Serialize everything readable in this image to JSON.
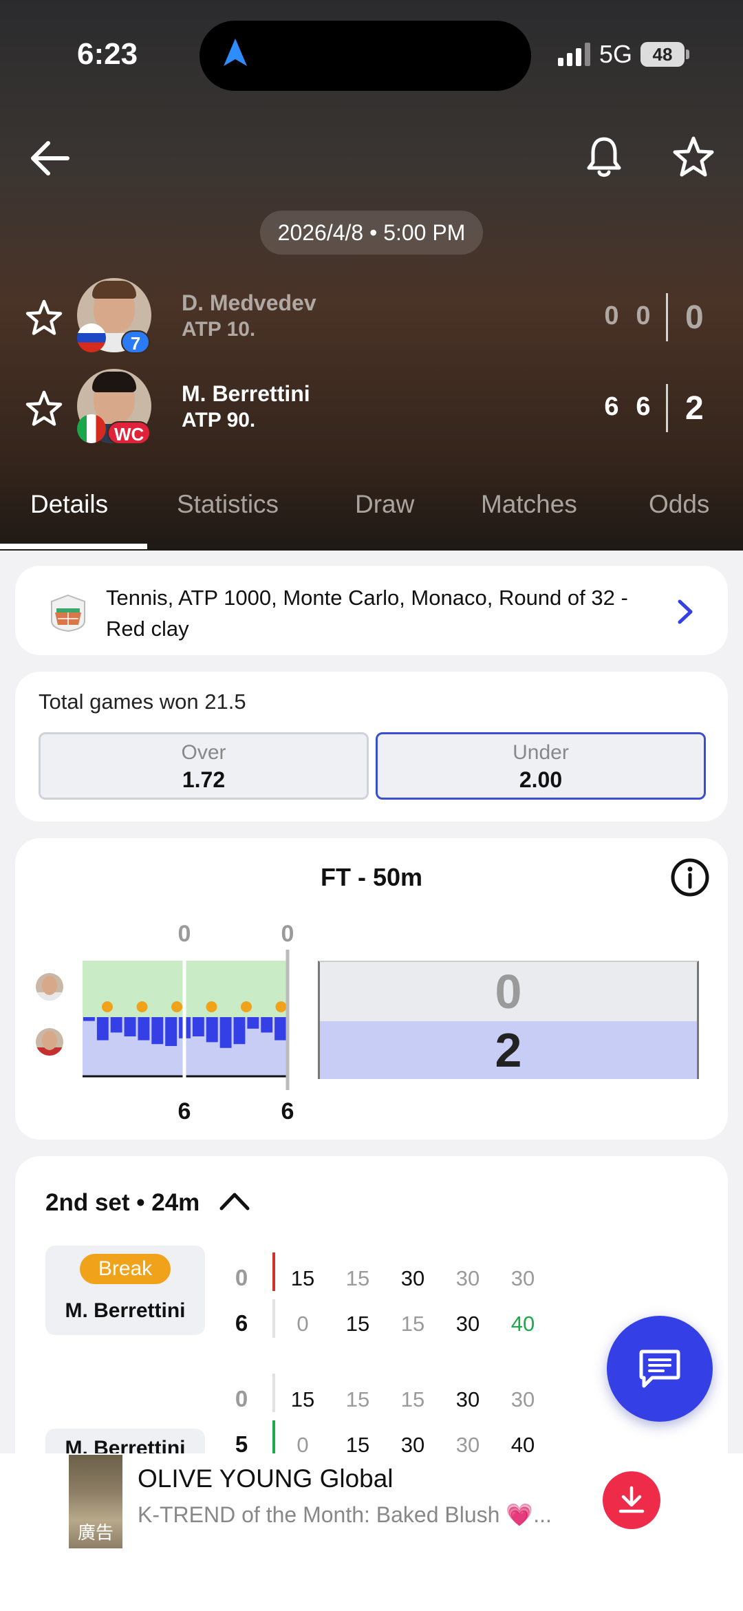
{
  "status_bar": {
    "time": "6:23",
    "network": "5G",
    "battery": "48"
  },
  "match": {
    "datetime": "2026/4/8 • 5:00 PM"
  },
  "players": [
    {
      "name": "D. Medvedev",
      "rank": "ATP 10.",
      "badge": "7",
      "sets": [
        "0",
        "0"
      ],
      "current": "0"
    },
    {
      "name": "M. Berrettini",
      "rank": "ATP 90.",
      "badge": "WC",
      "sets": [
        "6",
        "6"
      ],
      "current": "2"
    }
  ],
  "tabs": [
    "Details",
    "Statistics",
    "Draw",
    "Matches",
    "Odds"
  ],
  "tournament": {
    "text": "Tennis, ATP 1000, Monte Carlo, Monaco, Round of 32 - Red clay"
  },
  "bet": {
    "title": "Total games won 21.5",
    "over_label": "Over",
    "over_odds": "1.72",
    "under_label": "Under",
    "under_odds": "2.00"
  },
  "momentum": {
    "title": "FT - 50m",
    "set_top_scores": [
      "0",
      "0"
    ],
    "set_bottom_scores": [
      "6",
      "6"
    ],
    "score_top": "0",
    "score_bottom": "2",
    "bars": [
      0.1,
      0.6,
      0.4,
      0.5,
      0.6,
      0.7,
      0.75,
      0.55,
      0.5,
      0.65,
      0.8,
      0.7,
      0.3,
      0.4,
      0.6
    ]
  },
  "set_detail": {
    "header": "2nd set • 24m",
    "games": [
      {
        "badge": "Break",
        "server": "M. Berrettini",
        "score_top": "0",
        "score_bottom": "6",
        "points_top": [
          "15",
          "15",
          "30",
          "30",
          "30"
        ],
        "points_bottom": [
          "0",
          "15",
          "15",
          "30",
          "40"
        ]
      },
      {
        "server": "M. Berrettini",
        "score_top": "0",
        "score_bottom": "5",
        "points_top": [
          "15",
          "15",
          "15",
          "30",
          "30"
        ],
        "points_bottom": [
          "0",
          "15",
          "30",
          "30",
          "40"
        ]
      }
    ]
  },
  "ad": {
    "title": "OLIVE YOUNG Global",
    "subtitle": "K-TREND of the Month: Baked Blush 💗...",
    "thumb_label": "廣告"
  },
  "colors": {
    "accent": "#3440e6",
    "break": "#f0a21a",
    "win_point": "#1fa94a",
    "ad_button": "#ef2b4a"
  }
}
